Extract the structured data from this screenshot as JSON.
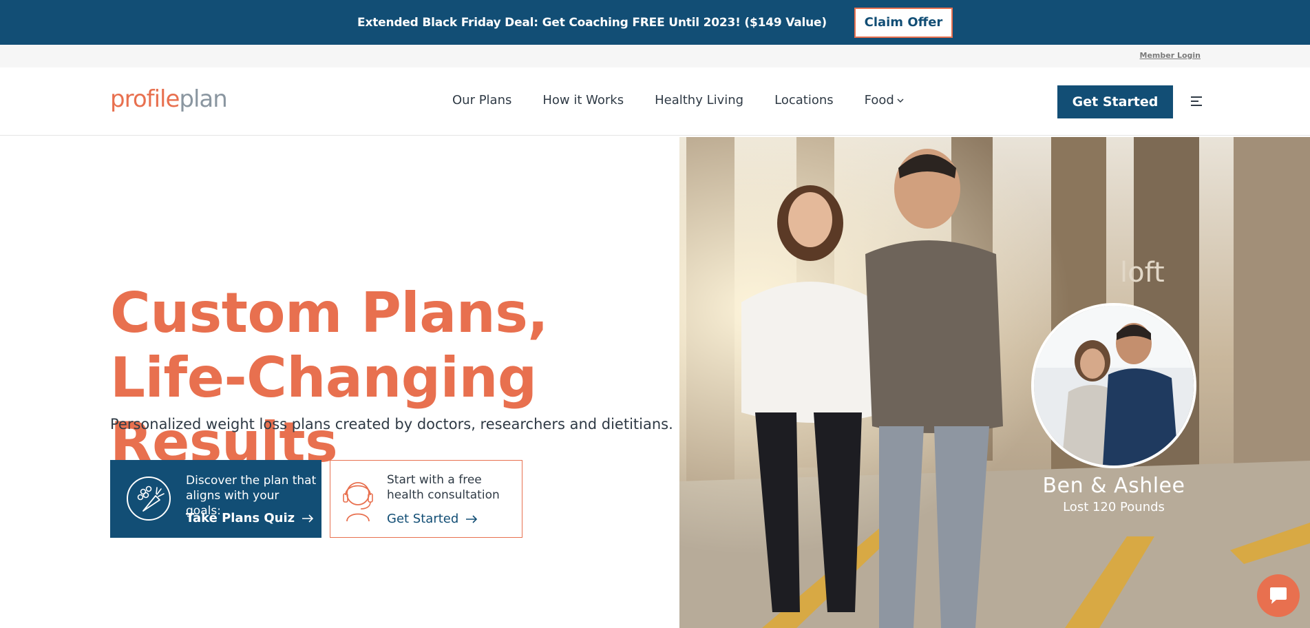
{
  "promo": {
    "text": "Extended Black Friday Deal: Get Coaching FREE Until 2023! ($149 Value)",
    "button_label": "Claim Offer"
  },
  "utility": {
    "member_login": "Member Login"
  },
  "header": {
    "logo_part1": "profile",
    "logo_part2": "plan",
    "nav": [
      {
        "label": "Our Plans"
      },
      {
        "label": "How it Works"
      },
      {
        "label": "Healthy Living"
      },
      {
        "label": "Locations"
      },
      {
        "label": "Food"
      }
    ],
    "cta_label": "Get Started"
  },
  "hero": {
    "title_line1": "Custom Plans,",
    "title_line2": "Life-Changing Results",
    "subtitle": "Personalized weight loss plans created by doctors, researchers and dietitians.",
    "quiz_card": {
      "text": "Discover the plan that aligns with your goals:",
      "cta": "Take Plans Quiz"
    },
    "consult_card": {
      "text": "Start with a free health consultation",
      "cta": "Get Started"
    },
    "testimonial": {
      "name": "Ben & Ashlee",
      "result": "Lost 120 Pounds"
    }
  },
  "colors": {
    "brand_blue": "#124e75",
    "brand_orange": "#e8704f"
  }
}
